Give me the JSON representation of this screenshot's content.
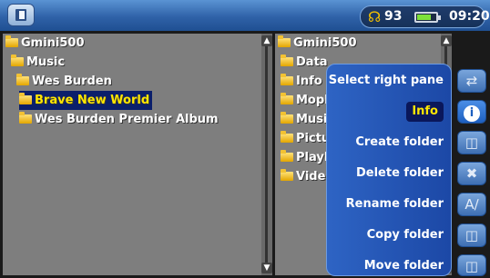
{
  "statusbar": {
    "volume": "93",
    "time": "09:20",
    "battery_level": 0.7
  },
  "left_pane": {
    "items": [
      {
        "label": "Gmini500"
      },
      {
        "label": "Music"
      },
      {
        "label": "Wes Burden"
      },
      {
        "label": "Brave New World"
      },
      {
        "label": "Wes Burden Premier Album"
      }
    ]
  },
  "right_pane": {
    "items": [
      {
        "label": "Gmini500"
      },
      {
        "label": "Data"
      },
      {
        "label": "Info"
      },
      {
        "label": "Moph"
      },
      {
        "label": "Musi"
      },
      {
        "label": "Pictu"
      },
      {
        "label": "Playl"
      },
      {
        "label": "Vide"
      }
    ]
  },
  "menu": {
    "items": [
      {
        "label": "Select right pane"
      },
      {
        "label": "Info"
      },
      {
        "label": "Create folder"
      },
      {
        "label": "Delete folder"
      },
      {
        "label": "Rename folder"
      },
      {
        "label": "Copy folder"
      },
      {
        "label": "Move folder"
      }
    ]
  },
  "sidebar_icons": [
    "swap-panes-icon",
    "info-icon",
    "create-folder-icon",
    "delete-icon",
    "rename-icon",
    "copy-icon",
    "move-icon"
  ],
  "colors": {
    "accent": "#2e64c4",
    "selection": "#0b1f6b",
    "highlight_text": "#ffe600",
    "folder": "#f2c233"
  }
}
